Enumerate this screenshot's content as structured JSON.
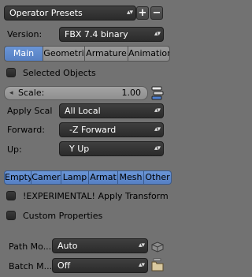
{
  "presets": {
    "label": "Operator Presets",
    "add_label": "+",
    "remove_label": "−",
    "arrows": "▴▾"
  },
  "version": {
    "label": "Version:",
    "value": "FBX 7.4 binary"
  },
  "tabs": [
    {
      "label": "Main",
      "active": true
    },
    {
      "label": "Geometri",
      "active": false
    },
    {
      "label": "Armature",
      "active": false
    },
    {
      "label": "Animation",
      "active": false
    }
  ],
  "selected_objects": {
    "label": "Selected Objects",
    "checked": false
  },
  "scale": {
    "label": "Scale:",
    "value": "1.00",
    "left_arrow": "◂"
  },
  "apply_scal": {
    "label": "Apply Scal",
    "value": "All Local"
  },
  "forward": {
    "label": "Forward:",
    "value": "-Z Forward"
  },
  "up": {
    "label": "Up:",
    "value": "Y Up"
  },
  "object_types": [
    "Empty",
    "Camer",
    "Lamp",
    "Armat",
    "Mesh",
    "Other"
  ],
  "experimental": {
    "label": "!EXPERIMENTAL! Apply Transform",
    "checked": false
  },
  "custom_props": {
    "label": "Custom Properties",
    "checked": false
  },
  "path_mode": {
    "label": "Path Mo...",
    "value": "Auto"
  },
  "batch_mode": {
    "label": "Batch M...",
    "value": "Off"
  }
}
